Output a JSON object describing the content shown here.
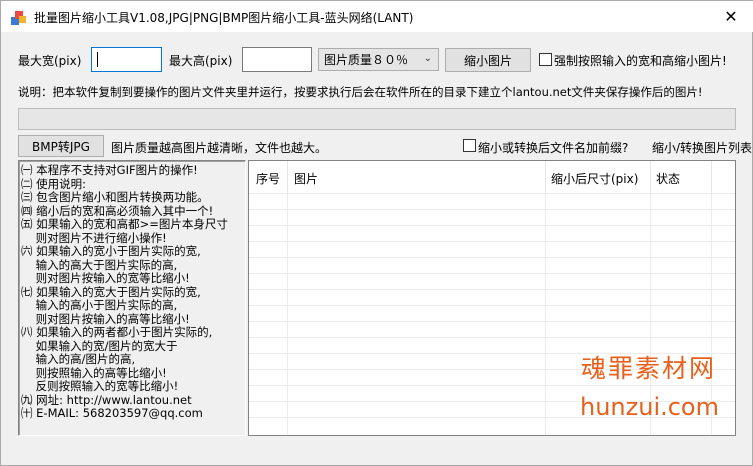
{
  "window": {
    "title": "批量图片缩小工具V1.08,JPG|PNG|BMP图片缩小工具-蓝头网络(LANT)",
    "close_glyph": "✕"
  },
  "resize_row": {
    "max_width_label": "最大宽(pix)",
    "max_width_value": "",
    "max_height_label": "最大高(pix)",
    "max_height_value": "",
    "quality_selected": "图片质量８０％",
    "shrink_button": "缩小图片",
    "force_checkbox_label": "强制按照输入的宽和高缩小图片!",
    "force_checked": false
  },
  "description": "说明：把本软件复制到要操作的图片文件夹里并运行，按要求执行后会在软件所在的目录下建立个lantou.net文件夹保存操作后的图片!",
  "progress": {
    "value": 0
  },
  "convert_row": {
    "bmp_to_jpg_button": "BMP转JPG",
    "quality_note": "图片质量越高图片越清晰，文件也越大。",
    "prefix_checkbox_label": "缩小或转换后文件名加前缀?",
    "prefix_checked": false,
    "list_title": "缩小/转换图片列表"
  },
  "instructions": [
    "㈠ 本程序不支持对GIF图片的操作!",
    "㈡ 使用说明:",
    "㈢ 包含图片缩小和图片转换两功能。",
    "㈣ 缩小后的宽和高必须输入其中一个!",
    "㈤ 如果输入的宽和高都>=图片本身尺寸",
    "    则对图片不进行缩小操作!",
    "㈥ 如果输入的宽小于图片实际的宽,",
    "    输入的高大于图片实际的高,",
    "    则对图片按输入的宽等比缩小!",
    "㈦ 如果输入的宽大于图片实际的宽,",
    "    输入的高小于图片实际的高,",
    "    则对图片按输入的高等比缩小!",
    "㈧ 如果输入的两者都小于图片实际的,",
    "    如果输入的宽/图片的宽大于",
    "    输入的高/图片的高,",
    "    则按照输入的高等比缩小!",
    "    反则按照输入的宽等比缩小!",
    "㈨ 网址: http://www.lantou.net",
    "㈩ E-MAIL: 568203597@qq.com"
  ],
  "table": {
    "columns": [
      "序号",
      "图片",
      "缩小后尺寸(pix)",
      "状态"
    ],
    "rows": []
  },
  "watermark": {
    "line1": "魂罪素材网",
    "line2": "hunzui.com",
    "color": "#e8601c"
  }
}
